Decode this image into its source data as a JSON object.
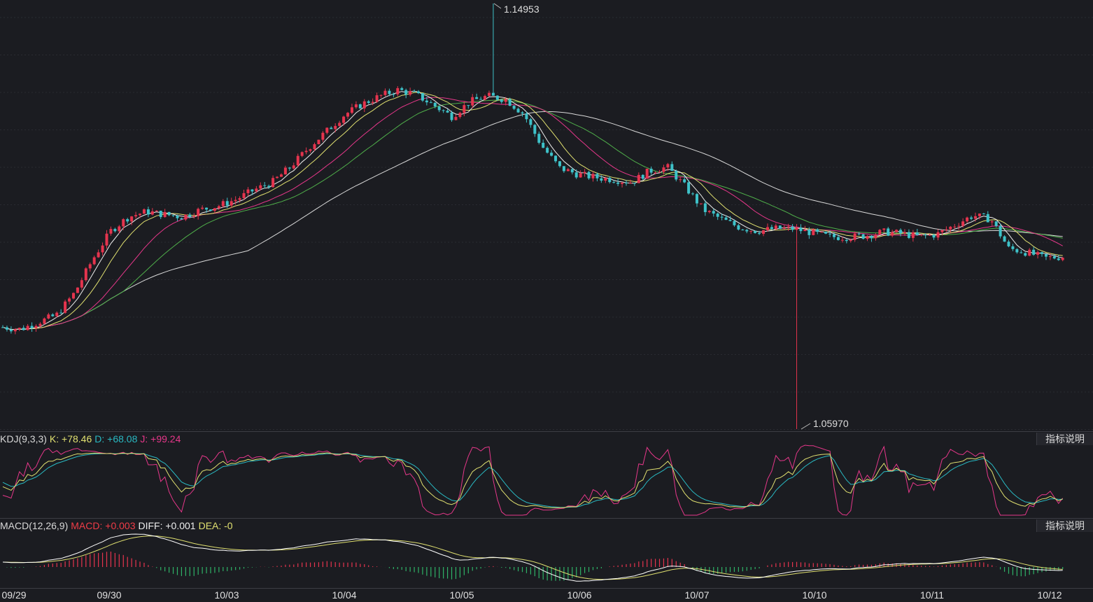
{
  "chart_data": {
    "type": "candlestick",
    "price_range": [
      1.0597,
      1.14953
    ],
    "annotations": {
      "high": "1.14953",
      "low": "1.05970"
    },
    "x_ticks": [
      "09/29",
      "09/30",
      "10/03",
      "10/04",
      "10/05",
      "10/06",
      "10/07",
      "10/10",
      "10/11",
      "10/12"
    ],
    "trend": [
      1.0812,
      1.0808,
      1.0823,
      1.0838,
      1.0885,
      1.0955,
      1.1015,
      1.1045,
      1.1056,
      1.105,
      1.1045,
      1.106,
      1.1068,
      1.1082,
      1.1102,
      1.1118,
      1.115,
      1.119,
      1.1225,
      1.126,
      1.1283,
      1.13,
      1.1313,
      1.1303,
      1.128,
      1.1257,
      1.1288,
      1.13,
      1.1293,
      1.1262,
      1.1195,
      1.1148,
      1.1135,
      1.1128,
      1.1124,
      1.1118,
      1.1142,
      1.115,
      1.1108,
      1.106,
      1.104,
      1.1023,
      1.1015,
      1.102,
      1.102,
      1.1012,
      1.1003,
      1.1002,
      1.1005,
      1.1013,
      1.101,
      1.1003,
      1.1008,
      1.1028,
      1.1048,
      1.104,
      1.0978,
      1.097,
      1.0958,
      1.0961
    ]
  },
  "indicators": {
    "kdj": {
      "label": "KDJ(9,3,3)",
      "k_label": "K: +78.46",
      "d_label": "D: +68.08",
      "j_label": "J: +99.24",
      "help": "指标说明",
      "colors": {
        "k": "#e0e070",
        "d": "#29b9c2",
        "j": "#e6378a"
      }
    },
    "macd": {
      "label": "MACD(12,26,9)",
      "macd_label": "MACD: +0.003",
      "diff_label": "DIFF: +0.001",
      "dea_label": "DEA: -0",
      "help": "指标说明",
      "colors": {
        "macd": "#f03c47",
        "diff": "#ffffff",
        "dea": "#e0e070"
      }
    }
  },
  "colors": {
    "up": "#e5344e",
    "down": "#3ec2c9",
    "ma_white": "#eeeeee",
    "ma_yellow": "#e0e070",
    "ma_pink": "#e6378a",
    "ma_green": "#4fae4a",
    "ma_slow": "#d9d9d9"
  }
}
